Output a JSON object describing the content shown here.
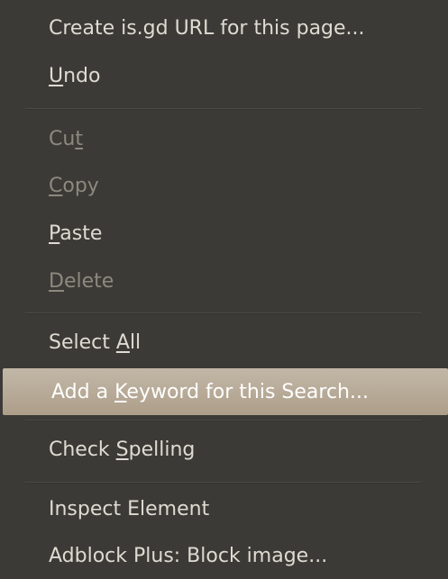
{
  "context_menu": {
    "items": [
      {
        "pre": "Create is.gd URL for this page...",
        "mn": "",
        "post": ""
      },
      {
        "pre": "",
        "mn": "U",
        "post": "ndo"
      },
      {
        "pre": "Cu",
        "mn": "t",
        "post": ""
      },
      {
        "pre": "",
        "mn": "C",
        "post": "opy"
      },
      {
        "pre": "",
        "mn": "P",
        "post": "aste"
      },
      {
        "pre": "",
        "mn": "D",
        "post": "elete"
      },
      {
        "pre": "Select ",
        "mn": "A",
        "post": "ll"
      },
      {
        "pre": "Add a ",
        "mn": "K",
        "post": "eyword for this Search..."
      },
      {
        "pre": "Check ",
        "mn": "S",
        "post": "pelling"
      },
      {
        "pre": "Inspect Element",
        "mn": "",
        "post": ""
      },
      {
        "pre": "Adblock Plus: Block image...",
        "mn": "",
        "post": ""
      }
    ],
    "colors": {
      "background": "#3b3a36",
      "text": "#dfdbd2",
      "disabled_text": "#8d897f",
      "highlight_top": "#c2b7a7",
      "highlight_bottom": "#ad9e89",
      "separator": "#4b4a45"
    }
  }
}
